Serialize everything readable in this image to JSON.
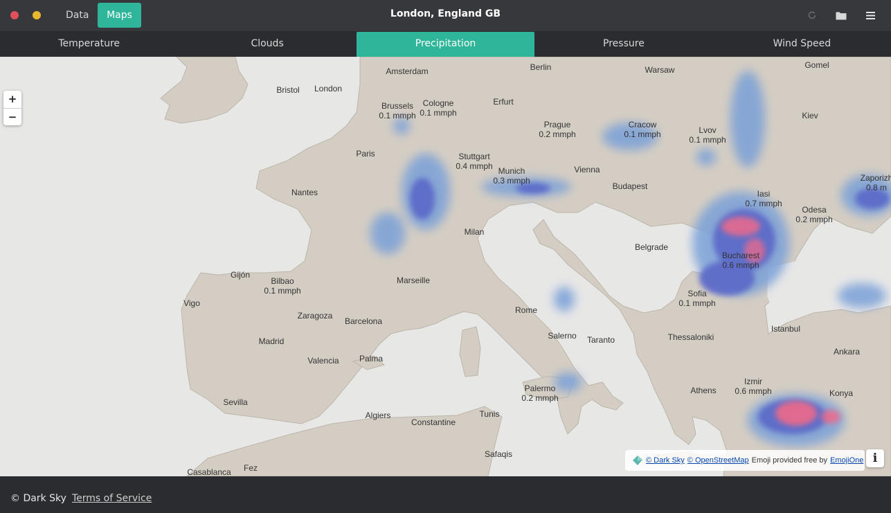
{
  "window": {
    "title": "London, England GB"
  },
  "top_tabs": [
    {
      "label": "Data"
    },
    {
      "label": "Maps"
    }
  ],
  "toolbar_icons": [
    "refresh-icon",
    "folder-icon",
    "menu-icon"
  ],
  "layer_tabs": [
    {
      "label": "Temperature"
    },
    {
      "label": "Clouds"
    },
    {
      "label": "Precipitation",
      "active": true
    },
    {
      "label": "Pressure"
    },
    {
      "label": "Wind Speed"
    }
  ],
  "map": {
    "zoom_in": "+",
    "zoom_out": "−",
    "cities": [
      {
        "name": "Amsterdam"
      },
      {
        "name": "Berlin"
      },
      {
        "name": "Warsaw"
      },
      {
        "name": "Gomel"
      },
      {
        "name": "Bristol"
      },
      {
        "name": "London"
      },
      {
        "name": "Brussels",
        "value": "0.1 mmph"
      },
      {
        "name": "Cologne",
        "value": "0.1 mmph"
      },
      {
        "name": "Erfurt"
      },
      {
        "name": "Prague",
        "value": "0.2 mmph"
      },
      {
        "name": "Cracow",
        "value": "0.1 mmph"
      },
      {
        "name": "Lvov",
        "value": "0.1 mmph"
      },
      {
        "name": "Kiev"
      },
      {
        "name": "Paris"
      },
      {
        "name": "Stuttgart",
        "value": "0.4 mmph"
      },
      {
        "name": "Munich",
        "value": "0.3 mmph"
      },
      {
        "name": "Vienna"
      },
      {
        "name": "Zaporizh",
        "value": "0.8 m"
      },
      {
        "name": "Nantes"
      },
      {
        "name": "Budapest"
      },
      {
        "name": "Iasi",
        "value": "0.7 mmph"
      },
      {
        "name": "Odesa",
        "value": "0.2 mmph"
      },
      {
        "name": "Milan"
      },
      {
        "name": "Belgrade"
      },
      {
        "name": "Bucharest",
        "value": "0.6 mmph"
      },
      {
        "name": "Gijón"
      },
      {
        "name": "Bilbao",
        "value": "0.1 mmph"
      },
      {
        "name": "Marseille"
      },
      {
        "name": "Vigo"
      },
      {
        "name": "Sofia",
        "value": "0.1 mmph"
      },
      {
        "name": "Zaragoza"
      },
      {
        "name": "Rome"
      },
      {
        "name": "Barcelona"
      },
      {
        "name": "Istanbul"
      },
      {
        "name": "Madrid"
      },
      {
        "name": "Salerno"
      },
      {
        "name": "Taranto"
      },
      {
        "name": "Thessaloniki"
      },
      {
        "name": "Valencia"
      },
      {
        "name": "Palma"
      },
      {
        "name": "Ankara"
      },
      {
        "name": "Izmir",
        "value": "0.6 mmph"
      },
      {
        "name": "Palermo",
        "value": "0.2 mmph"
      },
      {
        "name": "Sevilla"
      },
      {
        "name": "Athens"
      },
      {
        "name": "Konya"
      },
      {
        "name": "Algiers"
      },
      {
        "name": "Tunis"
      },
      {
        "name": "Constantine"
      },
      {
        "name": "Safaqis"
      },
      {
        "name": "Casablanca"
      },
      {
        "name": "Fez"
      }
    ],
    "attribution": {
      "darksky": "© Dark Sky",
      "osm": "© OpenStreetMap",
      "emoji_text": "Emoji provided free by",
      "emojione": "EmojiOne"
    },
    "info_button": "i"
  },
  "footer": {
    "copyright": "© Dark Sky",
    "terms": "Terms of Service"
  },
  "colors": {
    "accent": "#2fb59a",
    "bar": "#37383c",
    "bg": "#2b2c2f",
    "land": "#d4cdc3",
    "sea": "#e7e7e6",
    "precip_light": "#7aa0d8",
    "precip_mid": "#5a68c8",
    "precip_heavy": "#ee6a8a"
  }
}
